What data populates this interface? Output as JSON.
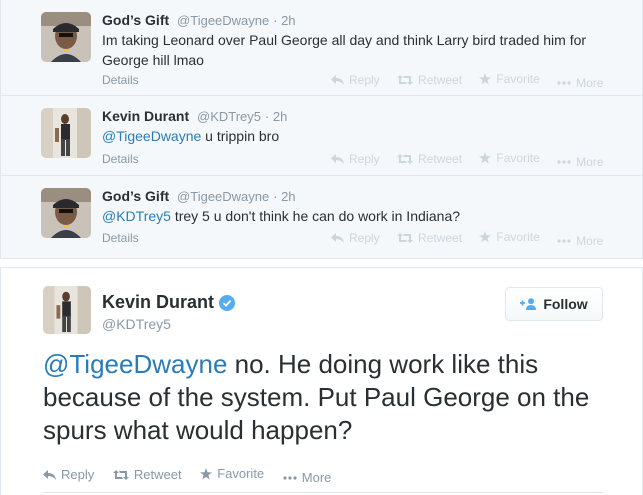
{
  "replies": [
    {
      "name": "God’s Gift",
      "handle": "@TigeeDwayne",
      "time": "· 2h",
      "mention": "",
      "text": "Im taking Leonard over Paul George all day and think Larry bird traded him for George hill lmao",
      "details": "Details",
      "avatar": "avatar-gods-gift"
    },
    {
      "name": "Kevin Durant",
      "handle": "@KDTrey5",
      "time": "· 2h",
      "mention": "@TigeeDwayne",
      "text": " u trippin bro",
      "details": "Details",
      "avatar": "avatar-kevin-durant"
    },
    {
      "name": "God’s Gift",
      "handle": "@TigeeDwayne",
      "time": "· 2h",
      "mention": "@KDTrey5",
      "text": " trey 5 u don't think he can do work in Indiana?",
      "details": "Details",
      "avatar": "avatar-gods-gift"
    }
  ],
  "reply_actions": {
    "reply": "Reply",
    "retweet": "Retweet",
    "favorite": "Favorite",
    "more": "More"
  },
  "main_tweet": {
    "name": "Kevin Durant",
    "handle": "@KDTrey5",
    "follow_label": "Follow",
    "mention": "@TigeeDwayne",
    "text": " no. He doing work like this because of the system. Put Paul George on the spurs what would happen?",
    "actions": {
      "reply": "Reply",
      "retweet": "Retweet",
      "favorite": "Favorite",
      "more": "More"
    }
  },
  "colors": {
    "link": "#2b7bb9",
    "verified": "#55acee",
    "muted": "#8899a6",
    "action_faded": "#ccd6dd",
    "thread_bg": "#f5f8fa"
  }
}
